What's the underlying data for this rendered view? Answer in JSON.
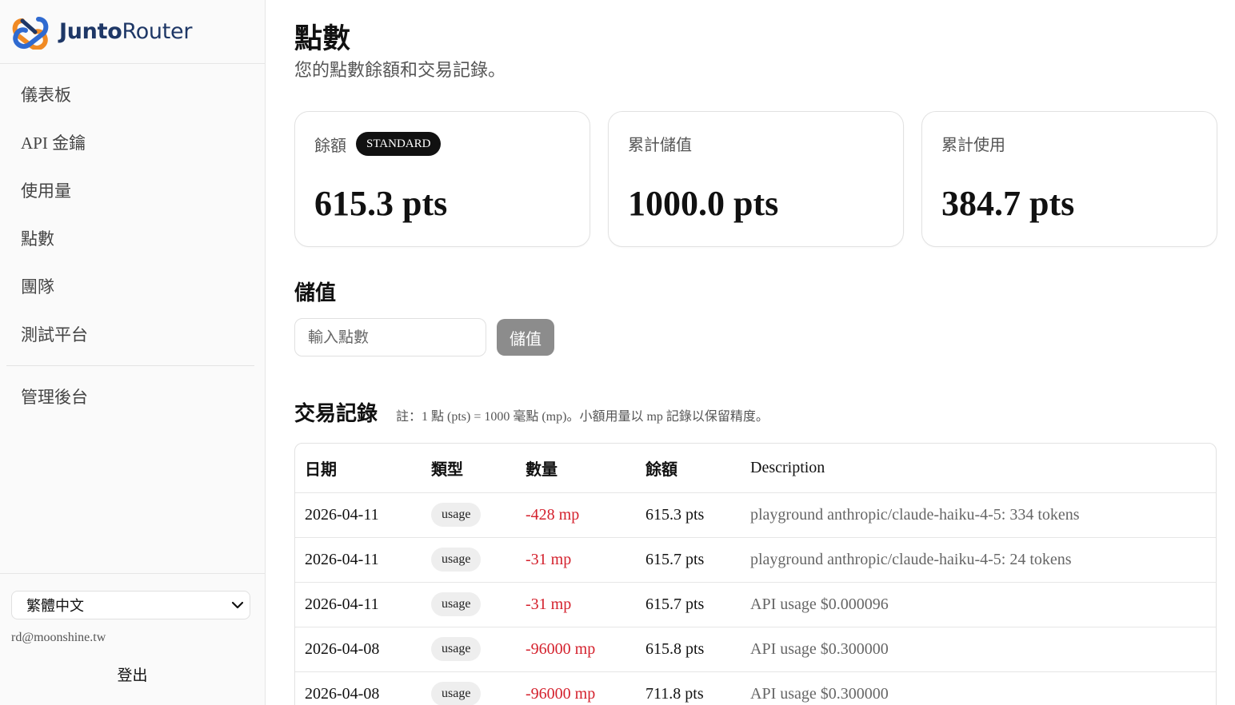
{
  "brand": {
    "name_bold": "Junto",
    "name_regular": "Router"
  },
  "sidebar": {
    "items": [
      {
        "label": "儀表板"
      },
      {
        "label": "API 金鑰"
      },
      {
        "label": "使用量"
      },
      {
        "label": "點數"
      },
      {
        "label": "團隊"
      },
      {
        "label": "測試平台"
      }
    ],
    "admin_label": "管理後台",
    "language": "繁體中文",
    "user_email": "rd@moonshine.tw",
    "logout_label": "登出"
  },
  "page": {
    "title": "點數",
    "subtitle": "您的點數餘額和交易記錄。"
  },
  "stats": {
    "balance": {
      "label": "餘額",
      "badge": "STANDARD",
      "value": "615.3 pts"
    },
    "total_topup": {
      "label": "累計儲值",
      "value": "1000.0 pts"
    },
    "total_used": {
      "label": "累計使用",
      "value": "384.7 pts"
    }
  },
  "topup": {
    "title": "儲值",
    "placeholder": "輸入點數",
    "button_label": "儲值"
  },
  "transactions": {
    "title": "交易記錄",
    "note": "註：1 點 (pts) = 1000 毫點 (mp)。小額用量以 mp 記錄以保留精度。",
    "columns": {
      "date": "日期",
      "type": "類型",
      "amount": "數量",
      "balance": "餘額",
      "description": "Description"
    },
    "rows": [
      {
        "date": "2026-04-11",
        "type": "usage",
        "amount": "-428 mp",
        "balance": "615.3 pts",
        "description": "playground anthropic/claude-haiku-4-5: 334 tokens"
      },
      {
        "date": "2026-04-11",
        "type": "usage",
        "amount": "-31 mp",
        "balance": "615.7 pts",
        "description": "playground anthropic/claude-haiku-4-5: 24 tokens"
      },
      {
        "date": "2026-04-11",
        "type": "usage",
        "amount": "-31 mp",
        "balance": "615.7 pts",
        "description": "API usage $0.000096"
      },
      {
        "date": "2026-04-08",
        "type": "usage",
        "amount": "-96000 mp",
        "balance": "615.8 pts",
        "description": "API usage $0.300000"
      },
      {
        "date": "2026-04-08",
        "type": "usage",
        "amount": "-96000 mp",
        "balance": "711.8 pts",
        "description": "API usage $0.300000"
      }
    ]
  },
  "colors": {
    "brand_navy": "#1e3766",
    "brand_blue": "#2f6ad0",
    "brand_orange": "#f08a24",
    "negative": "#d4202c"
  }
}
